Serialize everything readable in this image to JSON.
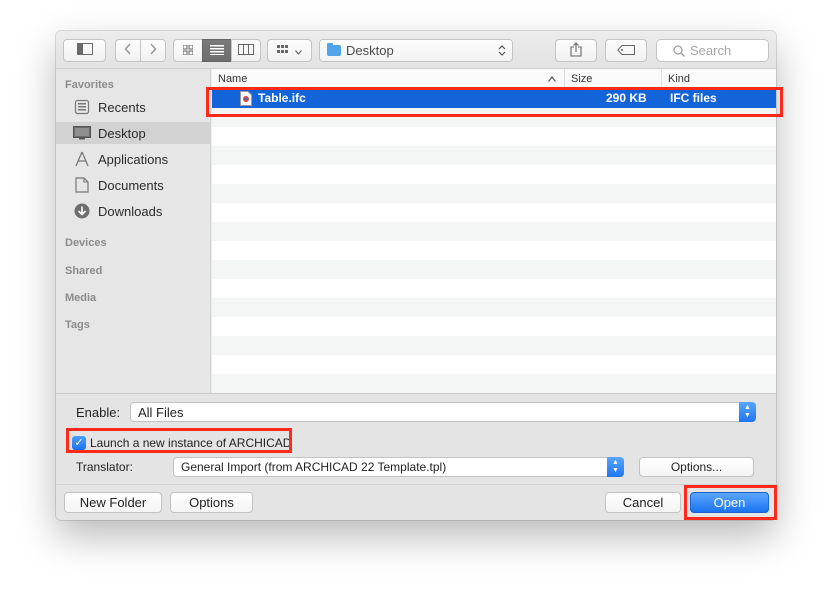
{
  "toolbar": {
    "location": "Desktop",
    "search_placeholder": "Search"
  },
  "sidebar": {
    "favorites_header": "Favorites",
    "items": [
      {
        "label": "Recents",
        "icon": "recents-icon"
      },
      {
        "label": "Desktop",
        "icon": "desktop-icon",
        "selected": true
      },
      {
        "label": "Applications",
        "icon": "applications-icon"
      },
      {
        "label": "Documents",
        "icon": "documents-icon"
      },
      {
        "label": "Downloads",
        "icon": "downloads-icon"
      }
    ],
    "sections": [
      "Devices",
      "Shared",
      "Media",
      "Tags"
    ]
  },
  "file_list": {
    "columns": {
      "name": "Name",
      "size": "Size",
      "kind": "Kind"
    },
    "rows": [
      {
        "name": "Table.ifc",
        "size": "290 KB",
        "kind": "IFC files",
        "selected": true
      }
    ]
  },
  "options": {
    "enable_label": "Enable:",
    "enable_value": "All Files",
    "launch_label": "Launch a new instance of ARCHICAD",
    "launch_checked": true,
    "translator_label": "Translator:",
    "translator_value": "General Import (from ARCHICAD 22 Template.tpl)",
    "translator_options_button": "Options..."
  },
  "footer": {
    "new_folder": "New Folder",
    "options": "Options",
    "cancel": "Cancel",
    "open": "Open"
  },
  "colors": {
    "selection": "#1364d9",
    "accent": "#1a73ef",
    "highlight": "#ff2a1a"
  }
}
